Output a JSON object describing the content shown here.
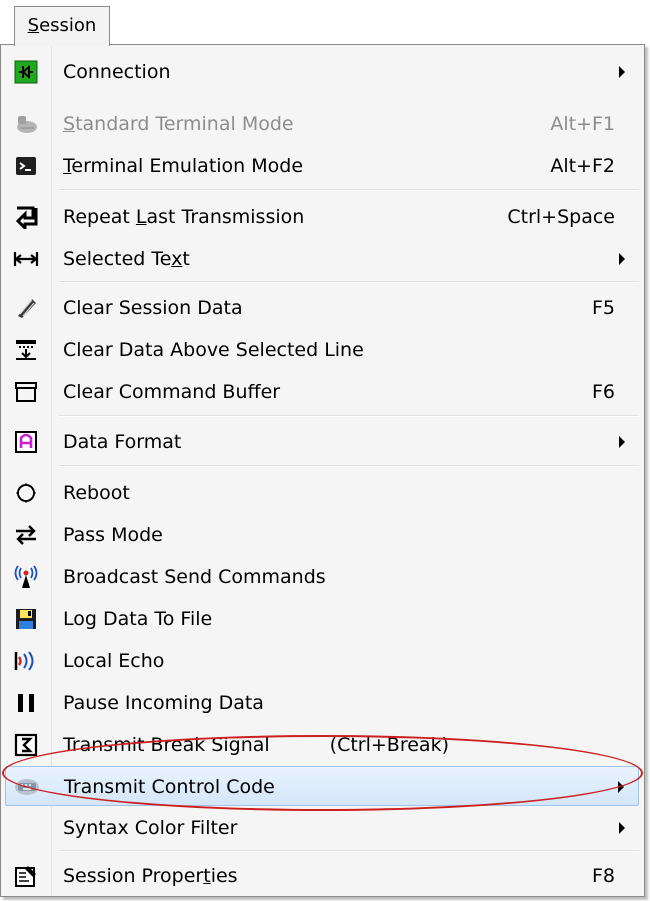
{
  "menubar": {
    "tab_mnemonic": "S",
    "tab_rest": "ession"
  },
  "menu": {
    "items": [
      {
        "icon": "connection-icon",
        "mnemonic": "",
        "rest": "Connection",
        "shortcut": "",
        "submenu": true
      },
      {
        "icon": "standard-terminal-icon",
        "mnemonic": "S",
        "rest": "tandard Terminal Mode",
        "shortcut": "Alt+F1",
        "disabled": true
      },
      {
        "icon": "terminal-emulation-icon",
        "mnemonic": "T",
        "rest": "erminal Emulation Mode",
        "shortcut": "Alt+F2"
      },
      {
        "icon": "repeat-icon",
        "pre": "Repeat ",
        "mnemonic": "L",
        "rest": "ast Transmission",
        "shortcut": "Ctrl+Space"
      },
      {
        "icon": "selected-text-icon",
        "pre": "Selected Te",
        "mnemonic": "x",
        "rest": "t",
        "shortcut": "",
        "submenu": true
      },
      {
        "icon": "clear-session-icon",
        "label": "Clear Session Data",
        "shortcut": "F5"
      },
      {
        "icon": "clear-above-icon",
        "label": "Clear Data Above Selected Line",
        "shortcut": ""
      },
      {
        "icon": "clear-buffer-icon",
        "label": "Clear Command Buffer",
        "shortcut": "F6"
      },
      {
        "icon": "data-format-icon",
        "label": "Data Format",
        "shortcut": "",
        "submenu": true
      },
      {
        "icon": "reboot-icon",
        "label": "Reboot",
        "shortcut": ""
      },
      {
        "icon": "pass-mode-icon",
        "label": "Pass Mode",
        "shortcut": ""
      },
      {
        "icon": "broadcast-icon",
        "label": "Broadcast Send Commands",
        "shortcut": ""
      },
      {
        "icon": "log-file-icon",
        "label": "Log Data To File",
        "shortcut": ""
      },
      {
        "icon": "local-echo-icon",
        "label": "Local Echo",
        "shortcut": ""
      },
      {
        "icon": "pause-icon",
        "label": "Pause Incoming Data",
        "shortcut": ""
      },
      {
        "icon": "break-signal-icon",
        "label": "Transmit Break Signal",
        "shortcut": "(Ctrl+Break)"
      },
      {
        "icon": "control-code-icon",
        "label": "Transmit Control Code",
        "shortcut": "",
        "submenu": true,
        "highlighted": true
      },
      {
        "icon": "",
        "label": "Syntax Color Filter",
        "shortcut": "",
        "submenu": true
      },
      {
        "icon": "properties-icon",
        "pre": "Session Proper",
        "mnemonic": "t",
        "rest": "ies",
        "shortcut": "F8"
      }
    ]
  },
  "colors": {
    "highlight_bg": "#d9eafb",
    "highlight_border": "#9ec5ee",
    "annotation_ring": "#cc1f1f",
    "disabled_text": "#8d8d8d"
  }
}
